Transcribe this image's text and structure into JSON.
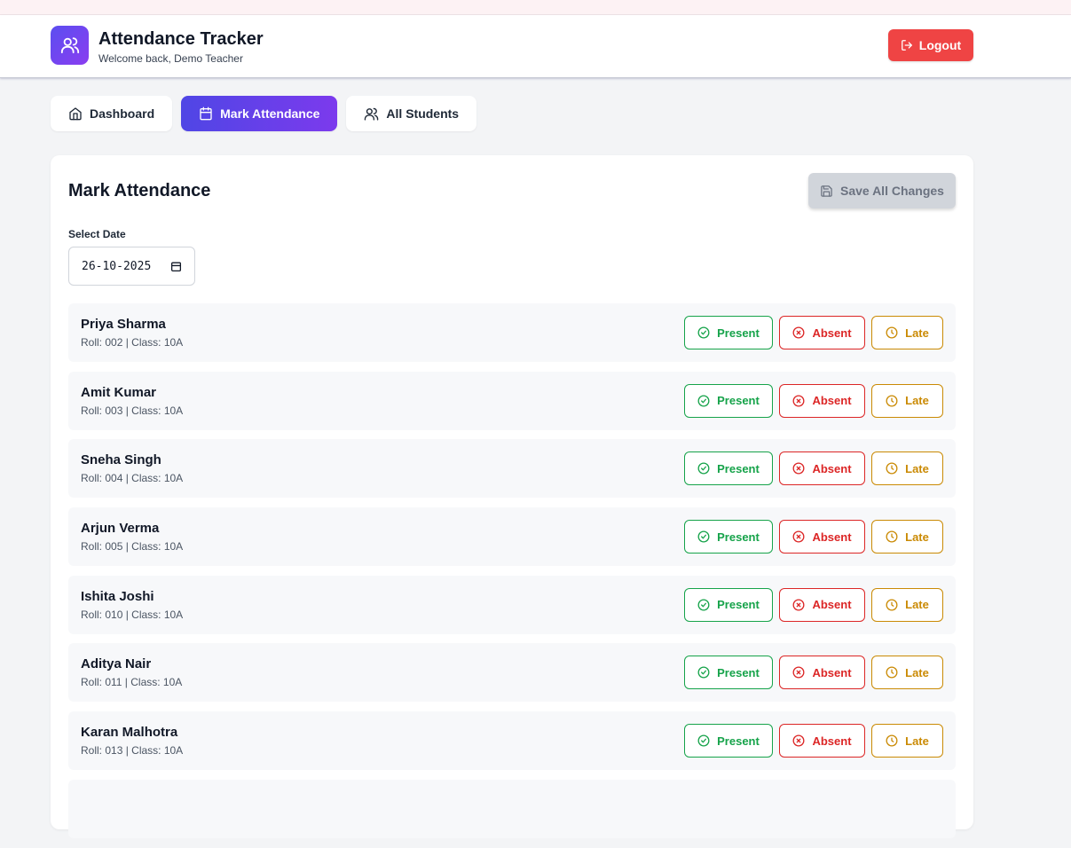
{
  "header": {
    "title": "Attendance Tracker",
    "subtitle": "Welcome back, Demo Teacher",
    "logout_label": "Logout"
  },
  "nav": {
    "tabs": [
      {
        "label": "Dashboard",
        "icon": "home-icon",
        "active": false
      },
      {
        "label": "Mark Attendance",
        "icon": "calendar-icon",
        "active": true
      },
      {
        "label": "All Students",
        "icon": "users-icon",
        "active": false
      }
    ]
  },
  "main": {
    "title": "Mark Attendance",
    "save_label": "Save All Changes",
    "date_label": "Select Date",
    "date_value": "26-10-2025",
    "actions": {
      "present": "Present",
      "absent": "Absent",
      "late": "Late"
    },
    "students": [
      {
        "name": "Priya Sharma",
        "meta": "Roll: 002 | Class: 10A"
      },
      {
        "name": "Amit Kumar",
        "meta": "Roll: 003 | Class: 10A"
      },
      {
        "name": "Sneha Singh",
        "meta": "Roll: 004 | Class: 10A"
      },
      {
        "name": "Arjun Verma",
        "meta": "Roll: 005 | Class: 10A"
      },
      {
        "name": "Ishita Joshi",
        "meta": "Roll: 010 | Class: 10A"
      },
      {
        "name": "Aditya Nair",
        "meta": "Roll: 011 | Class: 10A"
      },
      {
        "name": "Karan Malhotra",
        "meta": "Roll: 013 | Class: 10A"
      }
    ]
  },
  "colors": {
    "accent_start": "#4f46e5",
    "accent_end": "#7c3aed",
    "logout": "#ef4444",
    "present": "#16a34a",
    "absent": "#dc2626",
    "late": "#ca8a04"
  }
}
